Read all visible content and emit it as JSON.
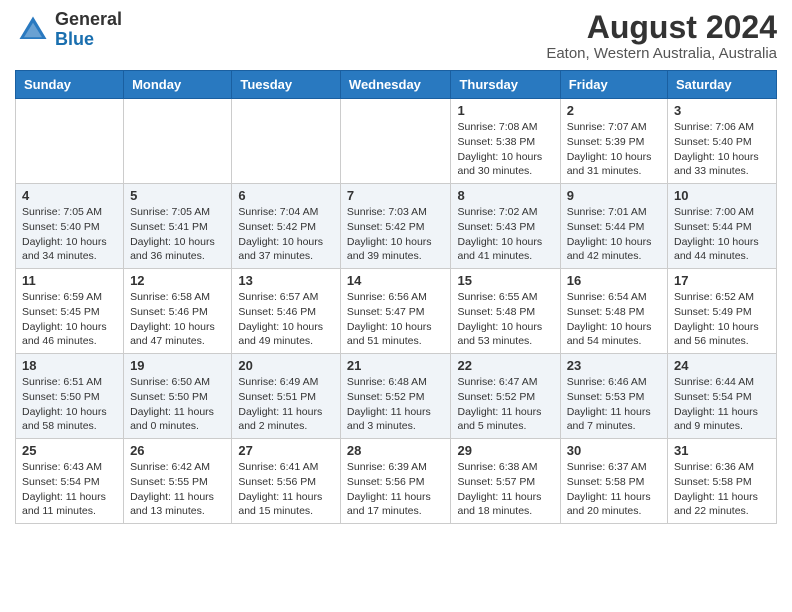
{
  "header": {
    "logo_line1": "General",
    "logo_line2": "Blue",
    "month_year": "August 2024",
    "location": "Eaton, Western Australia, Australia"
  },
  "days_of_week": [
    "Sunday",
    "Monday",
    "Tuesday",
    "Wednesday",
    "Thursday",
    "Friday",
    "Saturday"
  ],
  "weeks": [
    [
      {
        "day": "",
        "info": ""
      },
      {
        "day": "",
        "info": ""
      },
      {
        "day": "",
        "info": ""
      },
      {
        "day": "",
        "info": ""
      },
      {
        "day": "1",
        "info": "Sunrise: 7:08 AM\nSunset: 5:38 PM\nDaylight: 10 hours\nand 30 minutes."
      },
      {
        "day": "2",
        "info": "Sunrise: 7:07 AM\nSunset: 5:39 PM\nDaylight: 10 hours\nand 31 minutes."
      },
      {
        "day": "3",
        "info": "Sunrise: 7:06 AM\nSunset: 5:40 PM\nDaylight: 10 hours\nand 33 minutes."
      }
    ],
    [
      {
        "day": "4",
        "info": "Sunrise: 7:05 AM\nSunset: 5:40 PM\nDaylight: 10 hours\nand 34 minutes."
      },
      {
        "day": "5",
        "info": "Sunrise: 7:05 AM\nSunset: 5:41 PM\nDaylight: 10 hours\nand 36 minutes."
      },
      {
        "day": "6",
        "info": "Sunrise: 7:04 AM\nSunset: 5:42 PM\nDaylight: 10 hours\nand 37 minutes."
      },
      {
        "day": "7",
        "info": "Sunrise: 7:03 AM\nSunset: 5:42 PM\nDaylight: 10 hours\nand 39 minutes."
      },
      {
        "day": "8",
        "info": "Sunrise: 7:02 AM\nSunset: 5:43 PM\nDaylight: 10 hours\nand 41 minutes."
      },
      {
        "day": "9",
        "info": "Sunrise: 7:01 AM\nSunset: 5:44 PM\nDaylight: 10 hours\nand 42 minutes."
      },
      {
        "day": "10",
        "info": "Sunrise: 7:00 AM\nSunset: 5:44 PM\nDaylight: 10 hours\nand 44 minutes."
      }
    ],
    [
      {
        "day": "11",
        "info": "Sunrise: 6:59 AM\nSunset: 5:45 PM\nDaylight: 10 hours\nand 46 minutes."
      },
      {
        "day": "12",
        "info": "Sunrise: 6:58 AM\nSunset: 5:46 PM\nDaylight: 10 hours\nand 47 minutes."
      },
      {
        "day": "13",
        "info": "Sunrise: 6:57 AM\nSunset: 5:46 PM\nDaylight: 10 hours\nand 49 minutes."
      },
      {
        "day": "14",
        "info": "Sunrise: 6:56 AM\nSunset: 5:47 PM\nDaylight: 10 hours\nand 51 minutes."
      },
      {
        "day": "15",
        "info": "Sunrise: 6:55 AM\nSunset: 5:48 PM\nDaylight: 10 hours\nand 53 minutes."
      },
      {
        "day": "16",
        "info": "Sunrise: 6:54 AM\nSunset: 5:48 PM\nDaylight: 10 hours\nand 54 minutes."
      },
      {
        "day": "17",
        "info": "Sunrise: 6:52 AM\nSunset: 5:49 PM\nDaylight: 10 hours\nand 56 minutes."
      }
    ],
    [
      {
        "day": "18",
        "info": "Sunrise: 6:51 AM\nSunset: 5:50 PM\nDaylight: 10 hours\nand 58 minutes."
      },
      {
        "day": "19",
        "info": "Sunrise: 6:50 AM\nSunset: 5:50 PM\nDaylight: 11 hours\nand 0 minutes."
      },
      {
        "day": "20",
        "info": "Sunrise: 6:49 AM\nSunset: 5:51 PM\nDaylight: 11 hours\nand 2 minutes."
      },
      {
        "day": "21",
        "info": "Sunrise: 6:48 AM\nSunset: 5:52 PM\nDaylight: 11 hours\nand 3 minutes."
      },
      {
        "day": "22",
        "info": "Sunrise: 6:47 AM\nSunset: 5:52 PM\nDaylight: 11 hours\nand 5 minutes."
      },
      {
        "day": "23",
        "info": "Sunrise: 6:46 AM\nSunset: 5:53 PM\nDaylight: 11 hours\nand 7 minutes."
      },
      {
        "day": "24",
        "info": "Sunrise: 6:44 AM\nSunset: 5:54 PM\nDaylight: 11 hours\nand 9 minutes."
      }
    ],
    [
      {
        "day": "25",
        "info": "Sunrise: 6:43 AM\nSunset: 5:54 PM\nDaylight: 11 hours\nand 11 minutes."
      },
      {
        "day": "26",
        "info": "Sunrise: 6:42 AM\nSunset: 5:55 PM\nDaylight: 11 hours\nand 13 minutes."
      },
      {
        "day": "27",
        "info": "Sunrise: 6:41 AM\nSunset: 5:56 PM\nDaylight: 11 hours\nand 15 minutes."
      },
      {
        "day": "28",
        "info": "Sunrise: 6:39 AM\nSunset: 5:56 PM\nDaylight: 11 hours\nand 17 minutes."
      },
      {
        "day": "29",
        "info": "Sunrise: 6:38 AM\nSunset: 5:57 PM\nDaylight: 11 hours\nand 18 minutes."
      },
      {
        "day": "30",
        "info": "Sunrise: 6:37 AM\nSunset: 5:58 PM\nDaylight: 11 hours\nand 20 minutes."
      },
      {
        "day": "31",
        "info": "Sunrise: 6:36 AM\nSunset: 5:58 PM\nDaylight: 11 hours\nand 22 minutes."
      }
    ]
  ]
}
